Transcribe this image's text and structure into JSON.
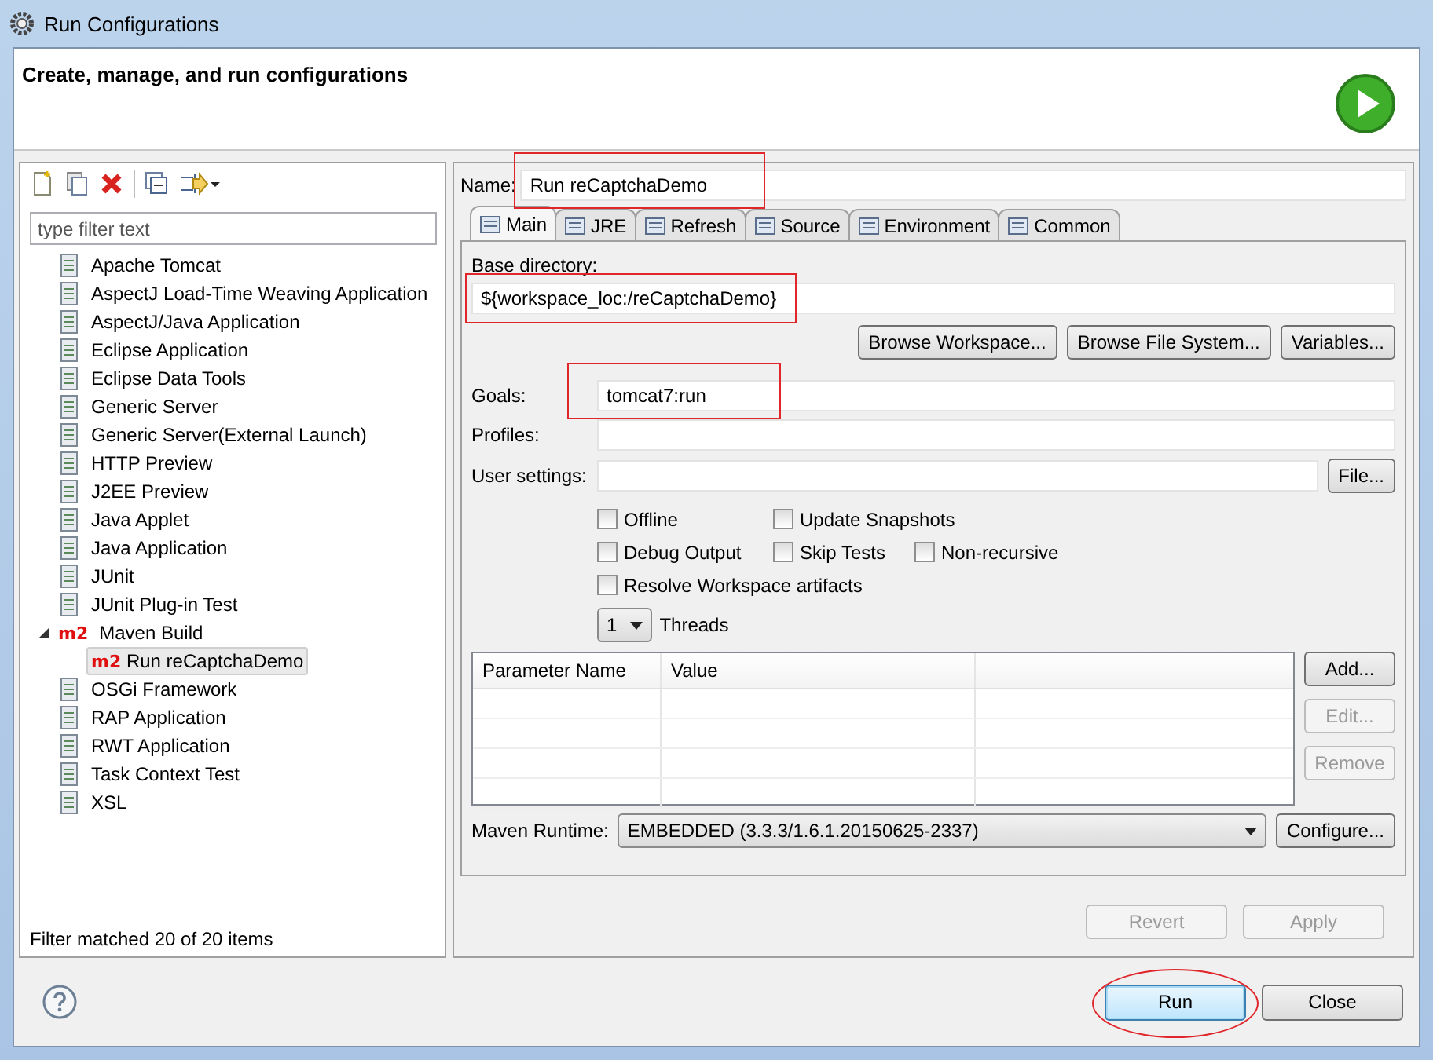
{
  "window": {
    "title": "Run Configurations"
  },
  "header": {
    "title": "Create, manage, and run configurations"
  },
  "sidebar": {
    "filter": {
      "placeholder": "type filter text"
    },
    "items": [
      {
        "label": "Apache Tomcat",
        "selected": false
      },
      {
        "label": "AspectJ Load-Time Weaving Application",
        "selected": false
      },
      {
        "label": "AspectJ/Java Application",
        "selected": false
      },
      {
        "label": "Eclipse Application",
        "selected": false
      },
      {
        "label": "Eclipse Data Tools",
        "selected": false
      },
      {
        "label": "Generic Server",
        "selected": false
      },
      {
        "label": "Generic Server(External Launch)",
        "selected": false
      },
      {
        "label": "HTTP Preview",
        "selected": false
      },
      {
        "label": "J2EE Preview",
        "selected": false
      },
      {
        "label": "Java Applet",
        "selected": false
      },
      {
        "label": "Java Application",
        "selected": false
      },
      {
        "label": "JUnit",
        "selected": false
      },
      {
        "label": "JUnit Plug-in Test",
        "selected": false
      },
      {
        "label": "Maven Build",
        "badge": "m2",
        "selected": false,
        "expanded": true,
        "children": [
          {
            "label": "Run reCaptchaDemo",
            "badge": "m2",
            "selected": true
          }
        ]
      },
      {
        "label": "OSGi Framework",
        "selected": false
      },
      {
        "label": "RAP Application",
        "selected": false
      },
      {
        "label": "RWT Application",
        "selected": false
      },
      {
        "label": "Task Context Test",
        "selected": false
      },
      {
        "label": "XSL",
        "selected": false
      }
    ],
    "status": "Filter matched 20 of 20 items"
  },
  "name_field": {
    "label": "Name:",
    "value": "Run reCaptchaDemo",
    "highlighted": true
  },
  "tabs": [
    {
      "label": "Main",
      "selected": true
    },
    {
      "label": "JRE",
      "selected": false
    },
    {
      "label": "Refresh",
      "selected": false
    },
    {
      "label": "Source",
      "selected": false
    },
    {
      "label": "Environment",
      "selected": false
    },
    {
      "label": "Common",
      "selected": false
    }
  ],
  "base_directory": {
    "label": "Base directory:",
    "value": "${workspace_loc:/reCaptchaDemo}",
    "highlighted": true
  },
  "browse_buttons": [
    "Browse Workspace...",
    "Browse File System...",
    "Variables..."
  ],
  "goals": {
    "label": "Goals:",
    "value": "tomcat7:run",
    "highlighted": true
  },
  "profiles": {
    "label": "Profiles:"
  },
  "user_settings": {
    "label": "User settings:",
    "button": "File..."
  },
  "option_rows": [
    [
      {
        "label": "Offline",
        "checked": false
      },
      {
        "label": "Update Snapshots",
        "checked": false
      }
    ],
    [
      {
        "label": "Debug Output",
        "checked": false
      },
      {
        "label": "Skip Tests",
        "checked": false
      },
      {
        "label": "Non-recursive",
        "checked": false
      }
    ],
    [
      {
        "label": "Resolve Workspace artifacts",
        "checked": false
      }
    ]
  ],
  "threads": {
    "value": "1",
    "label": "Threads"
  },
  "parameters": {
    "columns": [
      "Parameter Name",
      "Value"
    ],
    "buttons": [
      {
        "label": "Add...",
        "disabled": false
      },
      {
        "label": "Edit...",
        "disabled": true
      },
      {
        "label": "Remove",
        "disabled": true
      }
    ]
  },
  "maven_runtime": {
    "label": "Maven Runtime:",
    "value": "EMBEDDED (3.3.3/1.6.1.20150625-2337)",
    "button": "Configure..."
  },
  "form_buttons": [
    {
      "label": "Revert",
      "disabled": true
    },
    {
      "label": "Apply",
      "disabled": true
    }
  ],
  "dialog_buttons": [
    {
      "label": "Run",
      "default": true,
      "highlighted": true
    },
    {
      "label": "Close",
      "default": false,
      "highlighted": false
    }
  ]
}
